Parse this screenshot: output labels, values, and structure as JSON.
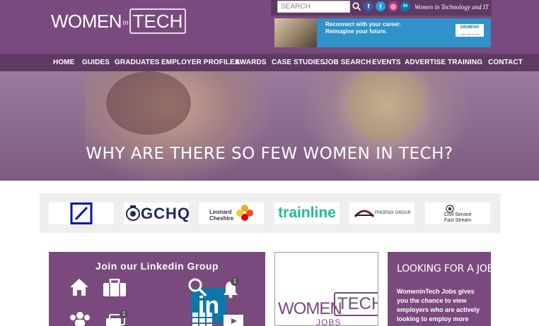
{
  "brand": {
    "logo_main": "WOMEN",
    "logo_in": "in",
    "logo_tech": "TECH",
    "tagline": "Women in Technology and IT"
  },
  "search": {
    "placeholder": "SEARCH"
  },
  "social": [
    {
      "name": "facebook-icon",
      "glyph": "f",
      "color": "#3b5998"
    },
    {
      "name": "twitter-icon",
      "glyph": "t",
      "color": "#1da1f2"
    },
    {
      "name": "instagram-icon",
      "glyph": "◎",
      "color": "#c13584"
    },
    {
      "name": "linkedin-icon",
      "glyph": "in",
      "color": "#0e76a8"
    }
  ],
  "ad": {
    "line1": "Reconnect with your career.",
    "line2": "Reimagine your future.",
    "logo": "SIEMENS",
    "logo_sub": "Ingenuity for life"
  },
  "nav": [
    "HOME",
    "GUIDES",
    "GRADUATES",
    "EMPLOYER PROFILES",
    "AWARDS",
    "CASE STUDIES",
    "JOB SEARCH",
    "EVENTS",
    "ADVERTISE",
    "TRAINING",
    "CONTACT"
  ],
  "hero": {
    "title": "WHY ARE THERE SO FEW WOMEN IN TECH?"
  },
  "sponsors": {
    "gchq": "GCHQ",
    "leonard_line1": "Leonard",
    "leonard_line2": "Cheshire",
    "trainline": "trainline",
    "phoenix": "PHOENIX GROUP",
    "civil_line1": "Civil Service",
    "civil_line2": "Fast Stream"
  },
  "linkedin": {
    "title": "Join our Linkedin Group",
    "logo": "in",
    "badges": [
      "1",
      "1"
    ]
  },
  "jobs": {
    "women": "WOMEN",
    "in": "in",
    "tech": "TECH",
    "sub": "JOBS"
  },
  "looking": {
    "title": "LOOKING FOR A JOB?",
    "text": "WomeninTech Jobs gives you the chance to view employers who are actively looking to employ more women in tech"
  },
  "colors": {
    "brand_purple": "#7a4a7e",
    "nav_purple": "#5e3a62",
    "ad_blue": "#2f92c9"
  }
}
